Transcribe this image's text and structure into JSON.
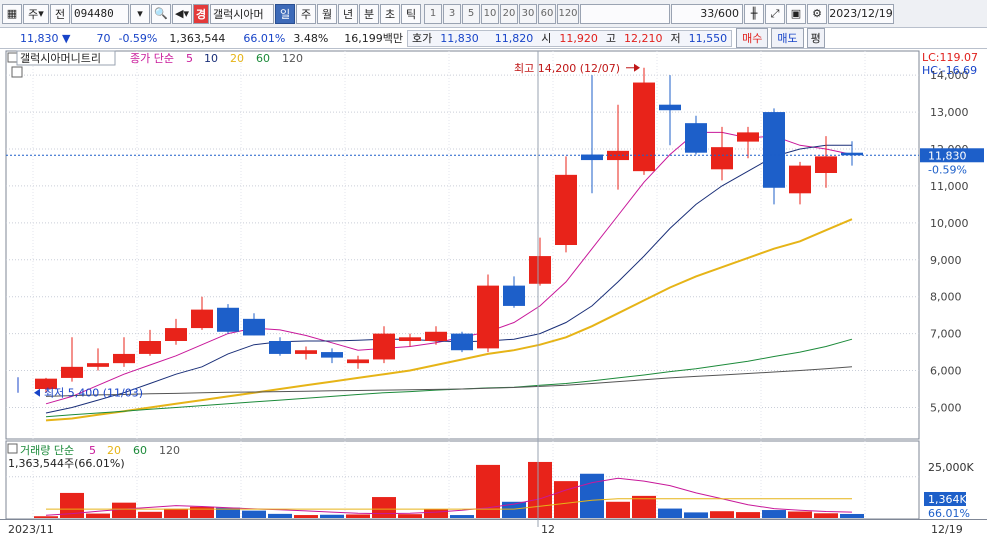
{
  "toolbar": {
    "market": "주",
    "market_btn": "전",
    "code": "094480",
    "name_badge": "경",
    "name": "갤럭시아머",
    "periods": [
      "일",
      "주",
      "월",
      "년",
      "분",
      "초",
      "틱"
    ],
    "selected_period": "일",
    "intervals": [
      "1",
      "3",
      "5",
      "10",
      "20",
      "30",
      "60",
      "120"
    ],
    "count": "33/600",
    "date": "2023/12/19"
  },
  "quote": {
    "price": "11,830",
    "direction": "▼",
    "change": "70",
    "change_pct": "-0.59%",
    "volume": "1,363,544",
    "volume_ratio": "66.01%",
    "turnover_pct": "3.48%",
    "amount": "16,199백만",
    "hoga_label": "호가",
    "ask": "11,830",
    "bid": "11,820",
    "open_label": "시",
    "open": "11,920",
    "high_label": "고",
    "high": "12,210",
    "low_label": "저",
    "low": "11,550",
    "buy_label": "매수",
    "sell_label": "매도",
    "eval_label": "평"
  },
  "chart_data": {
    "type": "candlestick",
    "title": "갤럭시아머니트리",
    "price_legend": {
      "label": "종가 단순",
      "periods": [
        "5",
        "10",
        "20",
        "60",
        "120"
      ],
      "colors": [
        "#c8189a",
        "#1a2f78",
        "#e6b417",
        "#1c8a3a",
        "#555555"
      ]
    },
    "volume_legend": {
      "label": "거래량 단순",
      "periods": [
        "5",
        "20",
        "60",
        "120"
      ],
      "colors": [
        "#c8189a",
        "#e6b417",
        "#1c8a3a",
        "#555555"
      ]
    },
    "volume_summary": "1,363,544주(66.01%)",
    "y_ticks": [
      "14,000",
      "13,000",
      "12,000",
      "11,000",
      "10,000",
      "9,000",
      "8,000",
      "7,000",
      "6,000",
      "5,000"
    ],
    "ylim": [
      4200,
      14600
    ],
    "volume_axis_label": "25,000K",
    "volume_current_label": "1,364K",
    "volume_ratio_label": "66.01%",
    "x_labels": [
      "2023/11",
      "12",
      "12/19"
    ],
    "lc_label": "LC:119.07",
    "hc_label": "HC:-16.69",
    "current_price_label": "11,830",
    "current_change_label": "-0.59%",
    "max_annotation": "최고 14,200 (12/07)",
    "min_annotation": "최저 5,400 (11/03)",
    "colors": {
      "up": "#e8231a",
      "down": "#1d5fc9"
    },
    "candles": [
      {
        "o": 5500,
        "h": 5800,
        "l": 5400,
        "c": 5780,
        "v": 600
      },
      {
        "o": 5800,
        "h": 6900,
        "l": 5700,
        "c": 6100,
        "v": 8500
      },
      {
        "o": 6100,
        "h": 6600,
        "l": 6000,
        "c": 6200,
        "v": 1500
      },
      {
        "o": 6200,
        "h": 6900,
        "l": 6100,
        "c": 6450,
        "v": 5200
      },
      {
        "o": 6450,
        "h": 7100,
        "l": 6400,
        "c": 6800,
        "v": 2100
      },
      {
        "o": 6800,
        "h": 7400,
        "l": 6700,
        "c": 7150,
        "v": 3100
      },
      {
        "o": 7150,
        "h": 8000,
        "l": 7100,
        "c": 7650,
        "v": 3800
      },
      {
        "o": 7700,
        "h": 7800,
        "l": 7000,
        "c": 7050,
        "v": 3500
      },
      {
        "o": 7400,
        "h": 7550,
        "l": 6950,
        "c": 6950,
        "v": 2500
      },
      {
        "o": 6800,
        "h": 6900,
        "l": 6400,
        "c": 6450,
        "v": 1400
      },
      {
        "o": 6450,
        "h": 6650,
        "l": 6300,
        "c": 6550,
        "v": 1000
      },
      {
        "o": 6500,
        "h": 6600,
        "l": 6200,
        "c": 6350,
        "v": 1100
      },
      {
        "o": 6200,
        "h": 6400,
        "l": 6050,
        "c": 6300,
        "v": 1200
      },
      {
        "o": 6300,
        "h": 7200,
        "l": 6200,
        "c": 7000,
        "v": 7100
      },
      {
        "o": 6800,
        "h": 7000,
        "l": 6650,
        "c": 6900,
        "v": 1300
      },
      {
        "o": 6800,
        "h": 7200,
        "l": 6700,
        "c": 7050,
        "v": 3000
      },
      {
        "o": 7000,
        "h": 7050,
        "l": 6500,
        "c": 6550,
        "v": 1000
      },
      {
        "o": 6600,
        "h": 8600,
        "l": 6500,
        "c": 8300,
        "v": 18000
      },
      {
        "o": 8300,
        "h": 8550,
        "l": 7700,
        "c": 7750,
        "v": 5500
      },
      {
        "o": 8350,
        "h": 9600,
        "l": 8300,
        "c": 9100,
        "v": 19000
      },
      {
        "o": 9400,
        "h": 11800,
        "l": 9200,
        "c": 11300,
        "v": 12500
      },
      {
        "o": 11850,
        "h": 14000,
        "l": 10800,
        "c": 11700,
        "v": 15000
      },
      {
        "o": 11700,
        "h": 13200,
        "l": 10900,
        "c": 11950,
        "v": 5500
      },
      {
        "o": 11400,
        "h": 14200,
        "l": 11300,
        "c": 13800,
        "v": 7500
      },
      {
        "o": 13200,
        "h": 14000,
        "l": 12100,
        "c": 13050,
        "v": 3200
      },
      {
        "o": 12700,
        "h": 12900,
        "l": 11850,
        "c": 11900,
        "v": 1900
      },
      {
        "o": 11450,
        "h": 12600,
        "l": 11150,
        "c": 12050,
        "v": 2300
      },
      {
        "o": 12200,
        "h": 12600,
        "l": 11750,
        "c": 12450,
        "v": 2000
      },
      {
        "o": 13000,
        "h": 13100,
        "l": 10500,
        "c": 10950,
        "v": 2700
      },
      {
        "o": 10800,
        "h": 11650,
        "l": 10500,
        "c": 11550,
        "v": 2200
      },
      {
        "o": 11350,
        "h": 12350,
        "l": 10950,
        "c": 11800,
        "v": 1600
      },
      {
        "o": 11900,
        "h": 12210,
        "l": 11550,
        "c": 11830,
        "v": 1364
      }
    ],
    "ma": {
      "ma5": [
        5100,
        5300,
        5600,
        5900,
        6150,
        6400,
        6700,
        7000,
        7150,
        7100,
        6950,
        6750,
        6550,
        6600,
        6650,
        6750,
        6900,
        7050,
        7300,
        7750,
        8400,
        9300,
        10200,
        11100,
        11850,
        12450,
        12450,
        12300,
        12350,
        12100,
        12000,
        11850
      ],
      "ma10": [
        4850,
        5000,
        5200,
        5400,
        5650,
        5900,
        6100,
        6450,
        6700,
        6780,
        6800,
        6800,
        6820,
        6850,
        6850,
        6800,
        6780,
        6800,
        6850,
        7000,
        7300,
        7750,
        8400,
        9100,
        9850,
        10500,
        11000,
        11400,
        11800,
        12000,
        12100,
        12100
      ],
      "ma20": [
        4650,
        4700,
        4800,
        4900,
        5000,
        5100,
        5200,
        5300,
        5400,
        5500,
        5600,
        5700,
        5800,
        5900,
        6000,
        6150,
        6300,
        6450,
        6550,
        6700,
        6900,
        7200,
        7550,
        7900,
        8250,
        8550,
        8800,
        9050,
        9300,
        9500,
        9800,
        10100
      ],
      "ma60": [
        4750,
        4800,
        4850,
        4900,
        4950,
        5000,
        5050,
        5100,
        5150,
        5200,
        5250,
        5300,
        5350,
        5400,
        5430,
        5470,
        5500,
        5530,
        5550,
        5600,
        5650,
        5720,
        5800,
        5880,
        5970,
        6050,
        6150,
        6250,
        6380,
        6500,
        6650,
        6850
      ],
      "ma120": [
        5300,
        5320,
        5340,
        5350,
        5370,
        5380,
        5400,
        5410,
        5420,
        5430,
        5440,
        5450,
        5460,
        5470,
        5480,
        5490,
        5500,
        5520,
        5540,
        5570,
        5600,
        5650,
        5700,
        5750,
        5800,
        5840,
        5880,
        5920,
        5960,
        6000,
        6050,
        6100
      ]
    },
    "vol_ma": {
      "ma5": [
        900,
        1500,
        2300,
        3000,
        3600,
        4200,
        3900,
        3500,
        3100,
        2800,
        2400,
        2000,
        1600,
        1500,
        1600,
        2000,
        2600,
        3500,
        4700,
        6500,
        9500,
        12000,
        13500,
        12500,
        11000,
        8500,
        6500,
        4500,
        3200,
        2600,
        2200,
        2000
      ],
      "ma20": [
        3000,
        3000,
        3000,
        3000,
        3000,
        3000,
        3000,
        3000,
        3000,
        3000,
        3000,
        3000,
        3000,
        3000,
        3000,
        3000,
        3000,
        3000,
        3000,
        4000,
        5000,
        6000,
        6500,
        6500,
        6500,
        6500,
        6500,
        6500,
        6500,
        6500,
        6500,
        6500
      ]
    }
  }
}
